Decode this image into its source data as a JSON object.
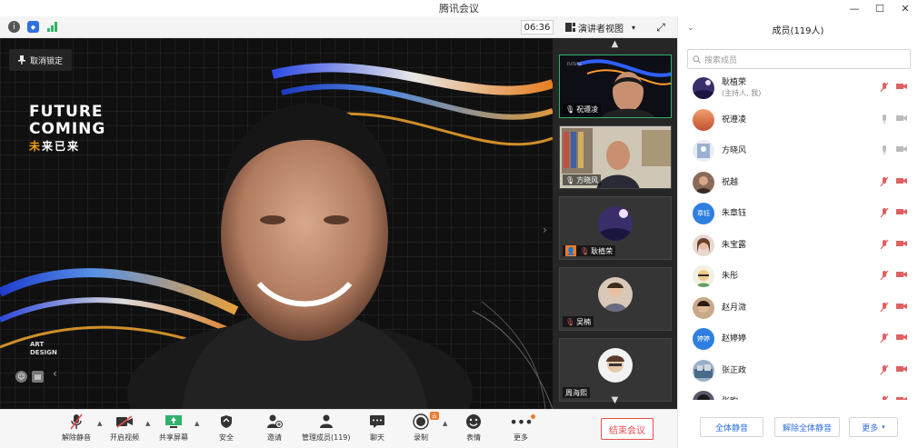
{
  "window": {
    "title": "腾讯会议",
    "controls": [
      "—",
      "☐",
      "✕"
    ]
  },
  "topbar": {
    "timer": "06:36",
    "view_mode": "演讲者视图",
    "view_caret": "▾",
    "expand_icon": "⤢",
    "info_icon": "i",
    "shield_icon": "◆",
    "signal_icon": "▮"
  },
  "main_video": {
    "unpin_label": "取消锁定",
    "brand_line1": "FUTURE",
    "brand_line2": "COMING",
    "brand_cn_highlight": "未",
    "brand_cn_rest": "来已来",
    "brand2_line1": "ART",
    "brand2_line2": "DESIGN"
  },
  "thumbnails": [
    {
      "name": "祝遵凌",
      "mic": "on",
      "active": true
    },
    {
      "name": "方晓风",
      "mic": "on",
      "active": false
    },
    {
      "name": "耿植荣",
      "mic": "off",
      "host": true,
      "active": false
    },
    {
      "name": "吴楠",
      "mic": "off",
      "active": false
    },
    {
      "name": "周海熙",
      "mic": "off",
      "active": false
    }
  ],
  "toolbar": {
    "items": [
      {
        "label": "解除静音",
        "icon": "mic-muted-icon"
      },
      {
        "label": "开启视频",
        "icon": "camera-off-icon"
      },
      {
        "label": "共享屏幕",
        "icon": "share-screen-icon"
      },
      {
        "label": "安全",
        "icon": "shield-icon"
      },
      {
        "label": "邀请",
        "icon": "invite-icon"
      },
      {
        "label": "管理成员(119)",
        "icon": "members-icon"
      },
      {
        "label": "聊天",
        "icon": "chat-icon"
      },
      {
        "label": "录制",
        "icon": "record-icon"
      },
      {
        "label": "表情",
        "icon": "emoji-icon"
      },
      {
        "label": "更多",
        "icon": "more-icon"
      }
    ],
    "record_badge": "云",
    "end_meeting": "结束会议"
  },
  "members_panel": {
    "title": "成员(119人)",
    "search_placeholder": "搜索成员",
    "members": [
      {
        "name": "耿植荣",
        "sub": "(主持人, 我)",
        "mic": "muted",
        "avatar_color": "#5a4a8a"
      },
      {
        "name": "祝遵凌",
        "sub": "",
        "mic": "on",
        "avatar_color": "#e8906a"
      },
      {
        "name": "方晓风",
        "sub": "",
        "mic": "on",
        "avatar_color": "#9bb0d0"
      },
      {
        "name": "祝越",
        "sub": "",
        "mic": "muted",
        "avatar_color": "#6b4a3a"
      },
      {
        "name": "朱章钰",
        "sub": "",
        "mic": "muted",
        "avatar_color": "#2f7fe0",
        "avatar_text": "章钰"
      },
      {
        "name": "朱宝露",
        "sub": "",
        "mic": "muted",
        "avatar_color": "#c89a8a"
      },
      {
        "name": "朱彤",
        "sub": "",
        "mic": "muted",
        "avatar_color": "#e0b040"
      },
      {
        "name": "赵月溦",
        "sub": "",
        "mic": "muted",
        "avatar_color": "#5a3a2a"
      },
      {
        "name": "赵婷婷",
        "sub": "",
        "mic": "muted",
        "avatar_color": "#2f7fe0",
        "avatar_text": "婷婷"
      },
      {
        "name": "张正政",
        "sub": "",
        "mic": "muted",
        "avatar_color": "#4a6a8a"
      },
      {
        "name": "张昀",
        "sub": "",
        "mic": "muted",
        "avatar_color": "#3a3a4a"
      }
    ],
    "footer": {
      "mute_all": "全体静音",
      "unmute_all": "解除全体静音",
      "more": "更多",
      "more_caret": "▾"
    }
  },
  "colors": {
    "accent_blue": "#2f6fe0",
    "end_red": "#e84d4d",
    "active_green": "#2fb36b",
    "muted_red": "#e06060"
  }
}
